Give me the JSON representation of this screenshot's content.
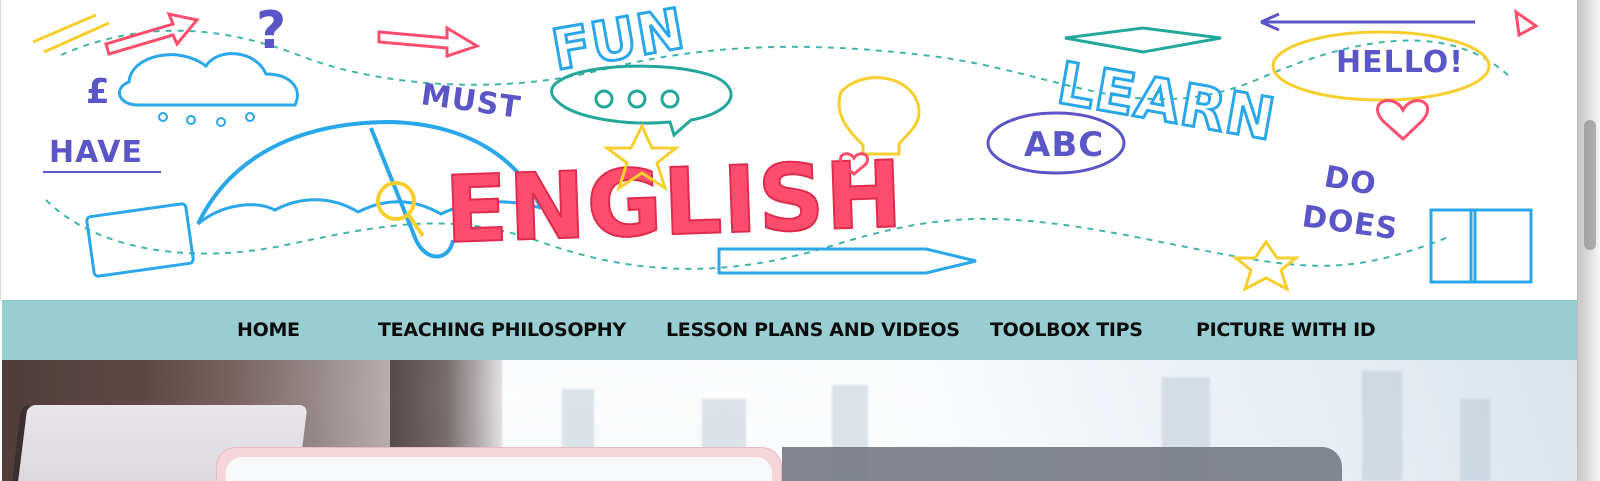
{
  "banner": {
    "main_word": "ENGLISH",
    "words": {
      "fun": "FUN",
      "must": "MUST",
      "have": "HAVE",
      "learn": "LEARN",
      "hello": "HELLO!",
      "abc": "ABC",
      "do": "DO",
      "does": "DOES"
    }
  },
  "nav": {
    "items": [
      "HOME",
      "TEACHING PHILOSOPHY",
      "LESSON PLANS AND VIDEOS",
      "TOOLBOX TIPS",
      "PICTURE WITH ID"
    ]
  },
  "colors": {
    "nav_bg": "#98cdd1",
    "main_word": "#ff4d6d",
    "accent_blue": "#2aa7e8",
    "accent_teal": "#23a79b",
    "accent_yellow": "#f6cf2f",
    "accent_purple": "#5a56c8"
  }
}
